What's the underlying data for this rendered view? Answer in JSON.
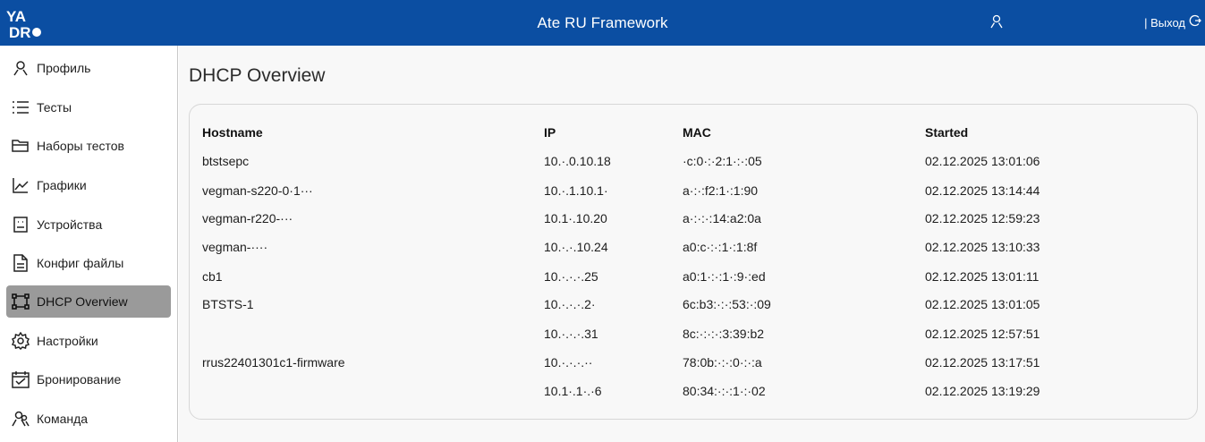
{
  "header": {
    "title": "Ate RU Framework",
    "logout_label": "| Выход",
    "logo_icon": "yadro-logo",
    "user_icon": "user-icon",
    "logout_icon": "logout-icon",
    "color": "#0b4ea2"
  },
  "sidebar": {
    "items": [
      {
        "label": "Профиль",
        "icon": "user-icon"
      },
      {
        "label": "Тесты",
        "icon": "list-icon"
      },
      {
        "label": "Наборы тестов",
        "icon": "folder-icon"
      },
      {
        "label": "Графики",
        "icon": "chart-line-icon"
      },
      {
        "label": "Устройства",
        "icon": "device-icon"
      },
      {
        "label": "Конфиг файлы",
        "icon": "file-icon"
      },
      {
        "label": "DHCP Overview",
        "icon": "network-icon",
        "active": true
      },
      {
        "label": "Настройки",
        "icon": "gear-icon"
      },
      {
        "label": "Бронирование",
        "icon": "calendar-check-icon"
      },
      {
        "label": "Команда",
        "icon": "team-icon"
      }
    ]
  },
  "main": {
    "title": "DHCP Overview",
    "table": {
      "columns": [
        "Hostname",
        "IP",
        "MAC",
        "Started"
      ],
      "rows": [
        {
          "hostname": "btstsepc",
          "ip": "10.·.0.10.18",
          "mac": "·c:0·:·2:1·:·:05",
          "started": "02.12.2025 13:01:06"
        },
        {
          "hostname": "vegman-s220-0·1···",
          "ip": "10.·.1.10.1·",
          "mac": "a·:·:f2:1·:1:90",
          "started": "02.12.2025 13:14:44"
        },
        {
          "hostname": "vegman-r220-···",
          "ip": "10.1·.10.20",
          "mac": "a·:·:·:14:a2:0a",
          "started": "02.12.2025 12:59:23"
        },
        {
          "hostname": "vegman-····",
          "ip": "10.·.·.10.24",
          "mac": "a0:c·:·:1·:1:8f",
          "started": "02.12.2025 13:10:33"
        },
        {
          "hostname": "cb1",
          "ip": "10.·.·.·.25",
          "mac": "a0:1·:·:1·:9·:ed",
          "started": "02.12.2025 13:01:11"
        },
        {
          "hostname": "BTSTS-1",
          "ip": "10.·.·.·.2·",
          "mac": "6c:b3:·:·:53:·:09",
          "started": "02.12.2025 13:01:05"
        },
        {
          "hostname": "",
          "ip": "10.·.·.·.31",
          "mac": "8c:·:·:·:3:39:b2",
          "started": "02.12.2025 12:57:51"
        },
        {
          "hostname": "rrus22401301c1-firmware",
          "ip": "10.·.·.·.··",
          "mac": "78:0b:·:·:0·:·:a",
          "started": "02.12.2025 13:17:51"
        },
        {
          "hostname": "",
          "ip": "10.1·.1·.·6",
          "mac": "80:34:·:·:1·:·02",
          "started": "02.12.2025 13:19:29"
        }
      ]
    }
  }
}
